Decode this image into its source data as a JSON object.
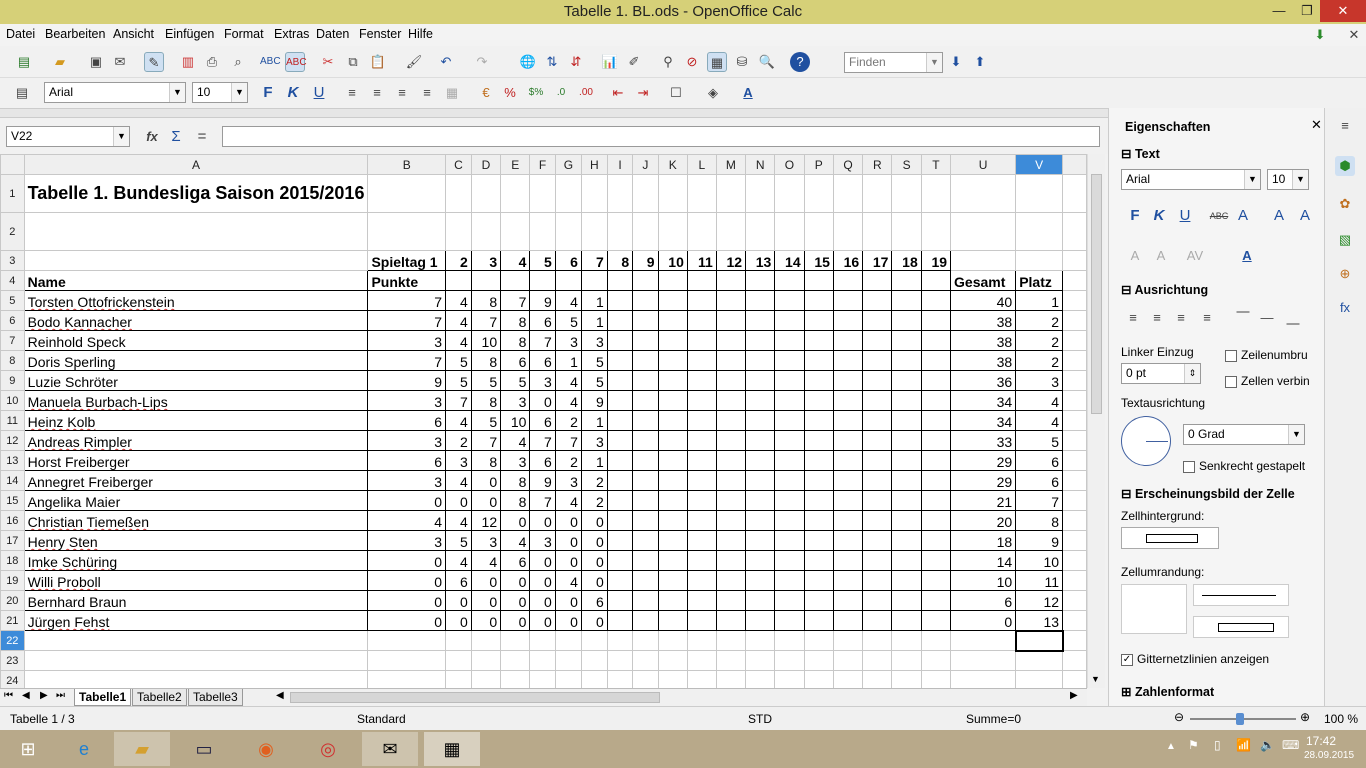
{
  "window": {
    "title": "Tabelle 1. BL.ods - OpenOffice Calc"
  },
  "menu": [
    "Datei",
    "Bearbeiten",
    "Ansicht",
    "Einfügen",
    "Format",
    "Extras",
    "Daten",
    "Fenster",
    "Hilfe"
  ],
  "toolbar": {
    "find_placeholder": "Finden"
  },
  "format_toolbar": {
    "font": "Arial",
    "size": "10"
  },
  "formula": {
    "cell_ref": "V22",
    "value": ""
  },
  "columns": [
    "A",
    "B",
    "C",
    "D",
    "E",
    "F",
    "G",
    "H",
    "I",
    "J",
    "K",
    "L",
    "M",
    "N",
    "O",
    "P",
    "Q",
    "R",
    "S",
    "T",
    "U",
    "V"
  ],
  "sheet": {
    "title": "Tabelle 1. Bundesliga Saison 2015/2016",
    "row3": [
      "Spieltag 1",
      "2",
      "3",
      "4",
      "5",
      "6",
      "7",
      "8",
      "9",
      "10",
      "11",
      "12",
      "13",
      "14",
      "15",
      "16",
      "17",
      "18",
      "19"
    ],
    "row4": {
      "name": "Name",
      "punkte": "Punkte",
      "gesamt": "Gesamt",
      "platz": "Platz"
    },
    "players": [
      {
        "name": "Torsten Ottofrickenstein",
        "scores": [
          "7",
          "4",
          "8",
          "7",
          "9",
          "4",
          "1"
        ],
        "gesamt": "40",
        "platz": "1"
      },
      {
        "name": "Bodo Kannacher",
        "scores": [
          "7",
          "4",
          "7",
          "8",
          "6",
          "5",
          "1"
        ],
        "gesamt": "38",
        "platz": "2"
      },
      {
        "name": "Reinhold Speck",
        "scores": [
          "3",
          "4",
          "10",
          "8",
          "7",
          "3",
          "3"
        ],
        "gesamt": "38",
        "platz": "2"
      },
      {
        "name": "Doris Sperling",
        "scores": [
          "7",
          "5",
          "8",
          "6",
          "6",
          "1",
          "5"
        ],
        "gesamt": "38",
        "platz": "2"
      },
      {
        "name": "Luzie Schröter",
        "scores": [
          "9",
          "5",
          "5",
          "5",
          "3",
          "4",
          "5"
        ],
        "gesamt": "36",
        "platz": "3"
      },
      {
        "name": "Manuela Burbach-Lips",
        "scores": [
          "3",
          "7",
          "8",
          "3",
          "0",
          "4",
          "9"
        ],
        "gesamt": "34",
        "platz": "4"
      },
      {
        "name": "Heinz Kolb",
        "scores": [
          "6",
          "4",
          "5",
          "10",
          "6",
          "2",
          "1"
        ],
        "gesamt": "34",
        "platz": "4"
      },
      {
        "name": "Andreas Rimpler",
        "scores": [
          "3",
          "2",
          "7",
          "4",
          "7",
          "7",
          "3"
        ],
        "gesamt": "33",
        "platz": "5"
      },
      {
        "name": "Horst Freiberger",
        "scores": [
          "6",
          "3",
          "8",
          "3",
          "6",
          "2",
          "1"
        ],
        "gesamt": "29",
        "platz": "6"
      },
      {
        "name": "Annegret Freiberger",
        "scores": [
          "3",
          "4",
          "0",
          "8",
          "9",
          "3",
          "2"
        ],
        "gesamt": "29",
        "platz": "6"
      },
      {
        "name": "Angelika Maier",
        "scores": [
          "0",
          "0",
          "0",
          "8",
          "7",
          "4",
          "2"
        ],
        "gesamt": "21",
        "platz": "7"
      },
      {
        "name": "Christian Tiemeßen",
        "scores": [
          "4",
          "4",
          "12",
          "0",
          "0",
          "0",
          "0"
        ],
        "gesamt": "20",
        "platz": "8"
      },
      {
        "name": "Henry Sten",
        "scores": [
          "3",
          "5",
          "3",
          "4",
          "3",
          "0",
          "0"
        ],
        "gesamt": "18",
        "platz": "9"
      },
      {
        "name": "Imke Schüring",
        "scores": [
          "0",
          "4",
          "4",
          "6",
          "0",
          "0",
          "0"
        ],
        "gesamt": "14",
        "platz": "10"
      },
      {
        "name": "Willi Proboll",
        "scores": [
          "0",
          "6",
          "0",
          "0",
          "0",
          "4",
          "0"
        ],
        "gesamt": "10",
        "platz": "11"
      },
      {
        "name": "Bernhard Braun",
        "scores": [
          "0",
          "0",
          "0",
          "0",
          "0",
          "0",
          "6"
        ],
        "gesamt": "6",
        "platz": "12"
      },
      {
        "name": "Jürgen Fehst",
        "scores": [
          "0",
          "0",
          "0",
          "0",
          "0",
          "0",
          "0"
        ],
        "gesamt": "0",
        "platz": "13"
      }
    ]
  },
  "tabs": [
    "Tabelle1",
    "Tabelle2",
    "Tabelle3"
  ],
  "status": {
    "sheet": "Tabelle 1 / 3",
    "style": "Standard",
    "mode": "STD",
    "sum": "Summe=0",
    "zoom": "100 %"
  },
  "sidebar": {
    "title": "Eigenschaften",
    "text_head": "Text",
    "font": "Arial",
    "size": "10",
    "align_head": "Ausrichtung",
    "indent_label": "Linker Einzug",
    "indent_value": "0 pt",
    "wrap_label": "Zeilenumbru",
    "merge_label": "Zellen verbin",
    "orient_label": "Textausrichtung",
    "angle": "0 Grad",
    "stacked_label": "Senkrecht gestapelt",
    "appearance_head": "Erscheinungsbild der Zelle",
    "bg_label": "Zellhintergrund:",
    "border_label": "Zellumrandung:",
    "grid_label": "Gitternetzlinien anzeigen",
    "number_head": "Zahlenformat"
  },
  "taskbar": {
    "time": "17:42",
    "date": "28.09.2015"
  }
}
